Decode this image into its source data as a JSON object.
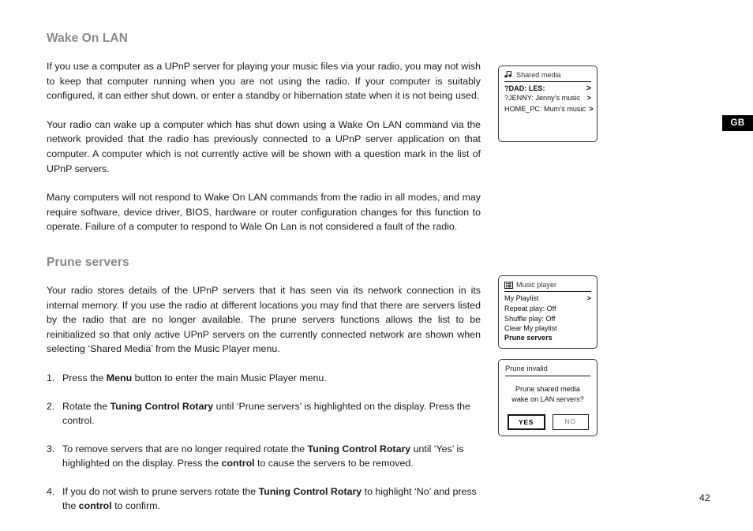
{
  "page": {
    "number": "42",
    "region_badge": "GB"
  },
  "sections": [
    {
      "heading": "Wake On LAN",
      "paragraphs": [
        "If you use a computer as a UPnP server for playing your music files via your radio, you may not wish to keep that computer running when you are not using the radio. If your computer is suitably configured, it can either shut down, or enter a standby or hibernation state when it is not being used.",
        "Your radio can wake up a computer which has shut down using a Wake On LAN command via the network provided that the radio has previously connected to a UPnP server application on that computer. A computer which is not currently active will be shown with a question mark in the list of UPnP servers.",
        "Many computers will not respond to Wake On LAN commands from the radio in all modes, and may require software, device driver, BIOS, hardware or router configuration changes for this function to operate. Failure of a computer to respond to Wale On Lan is not considered a fault of the radio."
      ]
    },
    {
      "heading": "Prune servers",
      "paragraphs": [
        "Your radio stores details of the UPnP servers that it has seen via its network connection in its internal memory. If you use the radio at different locations you may find that there are servers listed by the radio that are no longer available. The prune servers functions allows the list to be reinitialized so that only active UPnP servers on the currently connected network are shown when selecting ‘Shared Media’ from the Music Player menu."
      ]
    }
  ],
  "steps": [
    {
      "num": "1.",
      "html": "Press the <b>Menu</b> button to enter the main Music Player menu."
    },
    {
      "num": "2.",
      "html": "Rotate the <b>Tuning Control Rotary</b> until ‘Prune servers’ is highlighted on the display. Press the control."
    },
    {
      "num": "3.",
      "html": "To remove servers that are no longer required rotate the <b>Tuning Control Rotary</b> until ‘Yes’ is highlighted on the display. Press the <b>control</b> to cause the servers to be removed."
    },
    {
      "num": "4.",
      "html": "If you do not wish to prune servers rotate the <b>Tuning Control Rotary</b> to highlight ‘No’ and press the <b>control</b> to confirm."
    }
  ],
  "displays": {
    "shared_media": {
      "icon": "music-notes-icon",
      "title": "Shared media",
      "rows": [
        {
          "label": "?DAD: LES:",
          "chevron": ">",
          "selected": true
        },
        {
          "label": "?JENNY: Jenny’s music",
          "chevron": ">",
          "selected": false
        },
        {
          "label": "HOME_PC: Mum‘s music",
          "chevron": ">",
          "selected": false
        }
      ]
    },
    "music_player": {
      "icon": "list-icon",
      "title": "Music player",
      "rows": [
        {
          "label": "My Playlist",
          "chevron": ">",
          "selected": false
        },
        {
          "label": "Repeat play: Off",
          "chevron": "",
          "selected": false
        },
        {
          "label": "Shuffle play: Off",
          "chevron": "",
          "selected": false
        },
        {
          "label": "Clear My playlist",
          "chevron": "",
          "selected": false
        },
        {
          "label": "Prune servers",
          "chevron": "",
          "selected": true
        }
      ]
    },
    "prune_dialog": {
      "title": "Prune invalid",
      "message_line1": "Prune shared media",
      "message_line2": "wake on LAN servers?",
      "button_yes": "YES",
      "button_no": "NO"
    }
  },
  "colors": {
    "heading": "#888888",
    "body_text": "#1a1a1a",
    "badge_bg": "#000000",
    "badge_fg": "#ffffff"
  }
}
